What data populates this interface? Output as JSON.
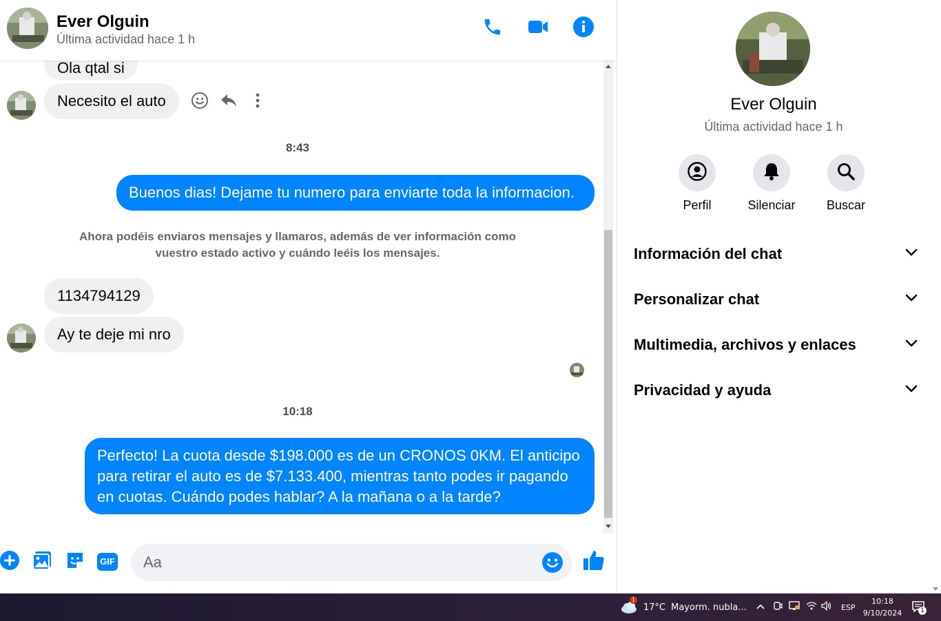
{
  "header": {
    "name": "Ever Olguin",
    "status": "Última actividad hace 1 h",
    "icons": [
      "phone-icon",
      "video-icon",
      "info-icon"
    ]
  },
  "messages": {
    "partial_top": "Ola qtal si",
    "msg1": "Necesito el auto",
    "msg1_actions": [
      "smile-icon",
      "reply-icon",
      "more-icon"
    ],
    "ts1": "8:43",
    "out1": "Buenos dias! Dejame tu numero para enviarte toda la informacion.",
    "system_line1": "Ahora podéis enviaros mensajes y llamaros, además de ver información como",
    "system_line2": "vuestro estado activo y cuándo leéis los mensajes.",
    "in2": "1134794129",
    "in3": "Ay te deje mi nro",
    "ts2": "10:18",
    "out2": "Perfecto! La cuota desde $198.000 es de un CRONOS 0KM. El anticipo para retirar el auto es de $7.133.400, mientras tanto podes ir pagando en cuotas. Cuándo podes hablar? A la mañana o a la tarde?"
  },
  "composer": {
    "placeholder": "Aa",
    "icons": [
      "plus-icon",
      "image-icon",
      "sticker-icon",
      "gif-icon",
      "emoji-icon",
      "like-icon"
    ],
    "gif_label": "GIF"
  },
  "details": {
    "name": "Ever Olguin",
    "status": "Última actividad hace 1 h",
    "actions": {
      "profile": "Perfil",
      "mute": "Silenciar",
      "search": "Buscar"
    },
    "sections": {
      "chat_info": "Información del chat",
      "customize": "Personalizar chat",
      "media": "Multimedia, archivos y enlaces",
      "privacy": "Privacidad y ayuda"
    }
  },
  "taskbar": {
    "weather_temp": "17°C",
    "weather_text": "Mayorm. nubla...",
    "weather_badge": "1",
    "language": "ESP",
    "time": "10:18",
    "date": "9/10/2024",
    "notification_count": "1"
  },
  "colors": {
    "accent": "#0084ff",
    "incoming_bubble": "#f0f0f0",
    "taskbar": "#221a33"
  }
}
